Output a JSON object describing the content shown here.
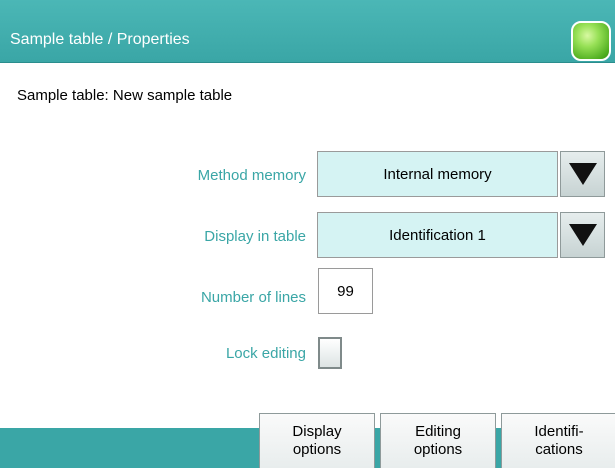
{
  "header": {
    "title": "Sample table / Properties",
    "status_light": "green-status-indicator"
  },
  "subtitle": "Sample table: New sample table",
  "form": {
    "method_memory": {
      "label": "Method memory",
      "value": "Internal memory"
    },
    "display_in_table": {
      "label": "Display in table",
      "value": "Identification 1"
    },
    "number_of_lines": {
      "label": "Number of lines",
      "value": "99"
    },
    "lock_editing": {
      "label": "Lock editing",
      "checked": false
    }
  },
  "softkeys": {
    "display_options": "Display\noptions",
    "editing_options": "Editing\noptions",
    "identifications": "Identifi-\ncations"
  },
  "colors": {
    "accent": "#3aa6a6",
    "field_bg": "#d5f3f3",
    "status_green": "#6ccc30"
  }
}
